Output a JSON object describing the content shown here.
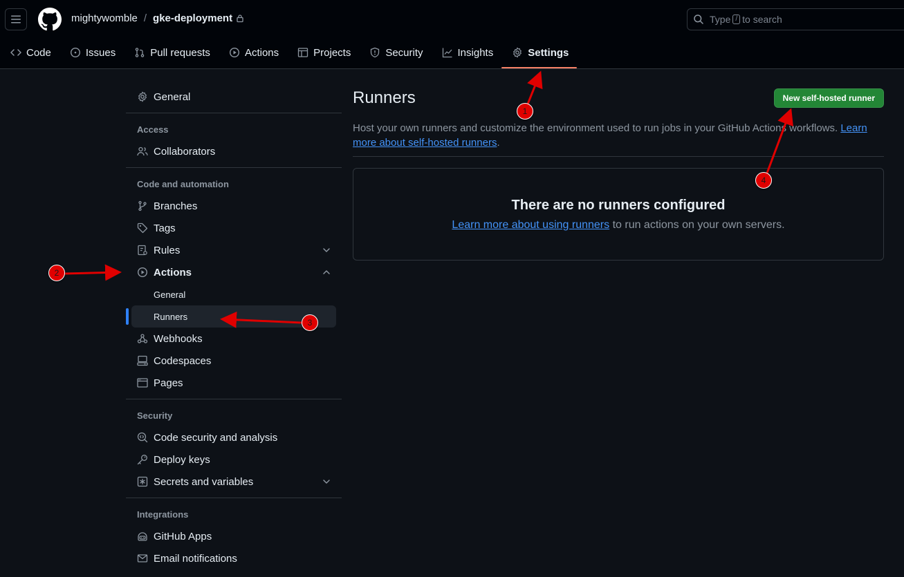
{
  "header": {
    "owner": "mightywomble",
    "separator": "/",
    "repo": "gke-deployment",
    "search": {
      "prefix": "Type",
      "key": "/",
      "suffix": "to search"
    }
  },
  "tabs": [
    {
      "label": "Code",
      "icon": "code-icon"
    },
    {
      "label": "Issues",
      "icon": "issue-icon"
    },
    {
      "label": "Pull requests",
      "icon": "pull-request-icon"
    },
    {
      "label": "Actions",
      "icon": "play-icon"
    },
    {
      "label": "Projects",
      "icon": "table-icon"
    },
    {
      "label": "Security",
      "icon": "shield-icon"
    },
    {
      "label": "Insights",
      "icon": "graph-icon"
    },
    {
      "label": "Settings",
      "icon": "gear-icon",
      "selected": true
    }
  ],
  "sidebar": {
    "general": "General",
    "access": {
      "title": "Access",
      "items": [
        "Collaborators"
      ]
    },
    "code": {
      "title": "Code and automation",
      "items": [
        "Branches",
        "Tags",
        "Rules",
        "Actions",
        "Webhooks",
        "Codespaces",
        "Pages"
      ],
      "actions_sub": [
        "General",
        "Runners"
      ]
    },
    "security": {
      "title": "Security",
      "items": [
        "Code security and analysis",
        "Deploy keys",
        "Secrets and variables"
      ]
    },
    "integrations": {
      "title": "Integrations",
      "items": [
        "GitHub Apps",
        "Email notifications"
      ]
    }
  },
  "main": {
    "title": "Runners",
    "new_button": "New self-hosted runner",
    "description": "Host your own runners and customize the environment used to run jobs in your GitHub Actions workflows.",
    "description_link": "Learn more about self-hosted runners",
    "description_end": ".",
    "blank_title": "There are no runners configured",
    "blank_link": "Learn more about using runners",
    "blank_text": " to run actions on your own servers."
  },
  "annotations": [
    "1",
    "2",
    "3",
    "4"
  ],
  "colors": {
    "accent": "#2f81f7",
    "tab_underline": "#f78166",
    "button": "#238636",
    "annotation": "#e00000",
    "link": "#4493f8"
  }
}
